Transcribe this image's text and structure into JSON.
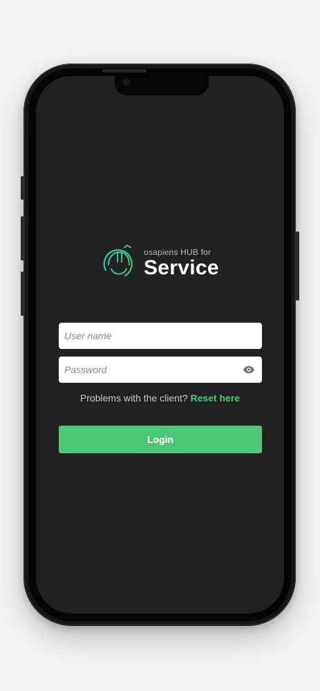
{
  "app": {
    "brand_sub": "osapiens HUB for",
    "brand_main": "Service"
  },
  "form": {
    "username_placeholder": "User name",
    "username_value": "",
    "password_placeholder": "Password",
    "password_value": ""
  },
  "help": {
    "text": "Problems with the client?",
    "link": "Reset here"
  },
  "actions": {
    "login_label": "Login"
  },
  "icons": {
    "logo": "helmet-logo-icon",
    "password_toggle": "eye-icon"
  },
  "colors": {
    "accent": "#4cc675",
    "logo_teal": "#2bb7a3",
    "screen_bg": "#212023"
  }
}
